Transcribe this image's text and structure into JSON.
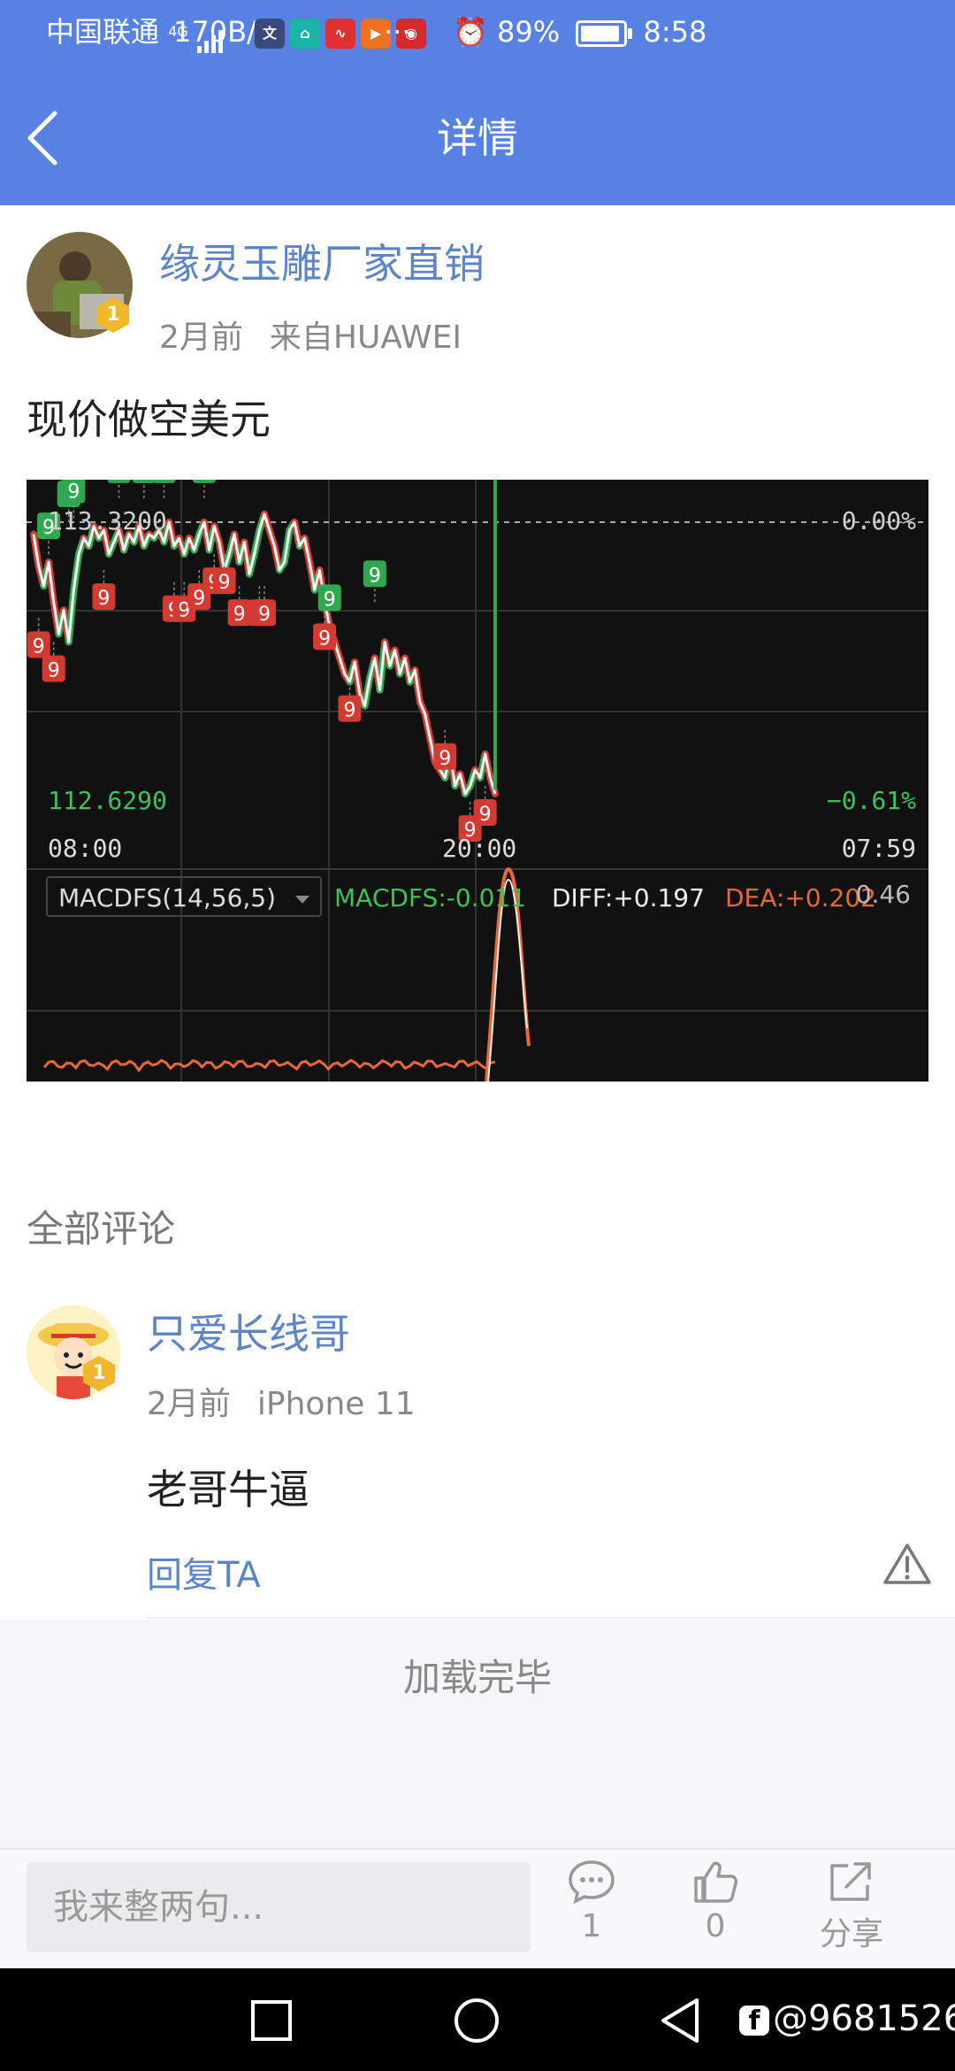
{
  "status_bar": {
    "carrier": "中国联通",
    "network": "4G",
    "speed": "170B/s",
    "more": "···",
    "battery": "89%",
    "time": "8:58",
    "apps": [
      {
        "icon": "wenjian-app-icon",
        "label": "文",
        "color": "#3a4a7a"
      },
      {
        "icon": "home-app-icon",
        "label": "⌂",
        "color": "#19b4a8"
      },
      {
        "icon": "chart-app-icon",
        "label": "∿",
        "color": "#e03030"
      },
      {
        "icon": "play-app-icon",
        "label": "▶",
        "color": "#f07020"
      },
      {
        "icon": "weibo-app-icon",
        "label": "◉",
        "color": "#d42a2a"
      }
    ]
  },
  "header": {
    "title": "详情"
  },
  "post": {
    "author": "缘灵玉雕厂家直销",
    "level": "1",
    "time": "2月前",
    "source": "来自HUAWEI",
    "content": "现价做空美元"
  },
  "chart_data": {
    "type": "line",
    "price_high": "113.3200",
    "price_low": "112.6290",
    "pct_top": "0.00%",
    "pct_bottom": "−0.61%",
    "x_ticks": [
      "08:00",
      "20:00",
      "07:59"
    ],
    "ylim": [
      112.629,
      113.32
    ],
    "series": [
      {
        "values": [
          113.29,
          113.21,
          113.16,
          113.22,
          113.12,
          113.04,
          113.1,
          113.02,
          113.15,
          113.24,
          113.28,
          113.26,
          113.31,
          113.28,
          113.3,
          113.24,
          113.27,
          113.3,
          113.25,
          113.29,
          113.27,
          113.31,
          113.26,
          113.29,
          113.28,
          113.3,
          113.27,
          113.32,
          113.26,
          113.28,
          113.24,
          113.28,
          113.25,
          113.29,
          113.32,
          113.25,
          113.31,
          113.27,
          113.2,
          113.24,
          113.29,
          113.22,
          113.27,
          113.19,
          113.24,
          113.3,
          113.34,
          113.3,
          113.26,
          113.2,
          113.22,
          113.3,
          113.32,
          113.26,
          113.28,
          113.22,
          113.15,
          113.2,
          113.12,
          113.06,
          113.02,
          112.98,
          112.94,
          112.92,
          112.97,
          112.89,
          112.86,
          112.93,
          112.98,
          112.9,
          113.02,
          112.96,
          113.0,
          112.94,
          112.98,
          112.92,
          112.95,
          112.87,
          112.84,
          112.78,
          112.72,
          112.7,
          112.68,
          112.74,
          112.66,
          112.69,
          112.64,
          112.66,
          112.7,
          112.68,
          112.74,
          112.68,
          112.64
        ]
      }
    ],
    "td_marks": [
      {
        "i": 3,
        "v": 113.24,
        "label": "9",
        "color": "#2fa84f",
        "pos": "above"
      },
      {
        "i": 7,
        "v": 113.32,
        "label": "9",
        "color": "#2fa84f",
        "pos": "above"
      },
      {
        "i": 8,
        "v": 113.33,
        "label": "9",
        "color": "#2fa84f",
        "pos": "above"
      },
      {
        "i": 17,
        "v": 113.38,
        "label": "9",
        "color": "#2fa84f",
        "pos": "above"
      },
      {
        "i": 22,
        "v": 113.38,
        "label": "9",
        "color": "#2fa84f",
        "pos": "above"
      },
      {
        "i": 26,
        "v": 113.38,
        "label": "9",
        "color": "#2fa84f",
        "pos": "above"
      },
      {
        "i": 34,
        "v": 113.38,
        "label": "9",
        "color": "#2fa84f",
        "pos": "above"
      },
      {
        "i": 59,
        "v": 113.06,
        "label": "9",
        "color": "#2fa84f",
        "pos": "above"
      },
      {
        "i": 68,
        "v": 113.12,
        "label": "9",
        "color": "#2fa84f",
        "pos": "above"
      },
      {
        "i": 1,
        "v": 113.08,
        "label": "9",
        "color": "#d23a32",
        "pos": "below"
      },
      {
        "i": 4,
        "v": 113.02,
        "label": "9",
        "color": "#d23a32",
        "pos": "below"
      },
      {
        "i": 14,
        "v": 113.2,
        "label": "9",
        "color": "#d23a32",
        "pos": "below"
      },
      {
        "i": 28,
        "v": 113.17,
        "label": "9",
        "color": "#d23a32",
        "pos": "below"
      },
      {
        "i": 30,
        "v": 113.17,
        "label": "9",
        "color": "#d23a32",
        "pos": "below"
      },
      {
        "i": 33,
        "v": 113.2,
        "label": "9",
        "color": "#d23a32",
        "pos": "below"
      },
      {
        "i": 36,
        "v": 113.24,
        "label": "9",
        "color": "#d23a32",
        "pos": "below"
      },
      {
        "i": 38,
        "v": 113.24,
        "label": "9",
        "color": "#d23a32",
        "pos": "below"
      },
      {
        "i": 41,
        "v": 113.16,
        "label": "9",
        "color": "#d23a32",
        "pos": "below"
      },
      {
        "i": 45,
        "v": 113.16,
        "label": "9",
        "color": "#d23a32",
        "pos": "below"
      },
      {
        "i": 46,
        "v": 113.16,
        "label": "9",
        "color": "#d23a32",
        "pos": "below"
      },
      {
        "i": 58,
        "v": 113.1,
        "label": "9",
        "color": "#d23a32",
        "pos": "below"
      },
      {
        "i": 63,
        "v": 112.92,
        "label": "9",
        "color": "#d23a32",
        "pos": "below"
      },
      {
        "i": 82,
        "v": 112.8,
        "label": "9",
        "color": "#d23a32",
        "pos": "below"
      },
      {
        "i": 87,
        "v": 112.62,
        "label": "9",
        "color": "#d23a32",
        "pos": "below"
      },
      {
        "i": 90,
        "v": 112.66,
        "label": "9",
        "color": "#d23a32",
        "pos": "below"
      }
    ],
    "macd": {
      "indicator": "MACDFS(14,56,5)",
      "macdfs": "MACDFS:-0.011",
      "diff": "DIFF:+0.197",
      "dea": "DEA:+0.202",
      "right_value": "0.46"
    }
  },
  "comments": {
    "section_title": "全部评论",
    "items": [
      {
        "author": "只爱长线哥",
        "level": "1",
        "time": "2月前",
        "device": "iPhone 11",
        "text": "老哥牛逼",
        "reply_label": "回复TA"
      }
    ]
  },
  "footer": {
    "loaded_text": "加载完毕"
  },
  "bottom_bar": {
    "placeholder": "我来整两句...",
    "comment_count": "1",
    "like_count": "0",
    "share_label": "分享"
  },
  "watermark": "@9681526",
  "colors": {
    "accent": "#5782e4",
    "link": "#5e84c8",
    "up": "#2fa84f",
    "down": "#d23a32"
  }
}
